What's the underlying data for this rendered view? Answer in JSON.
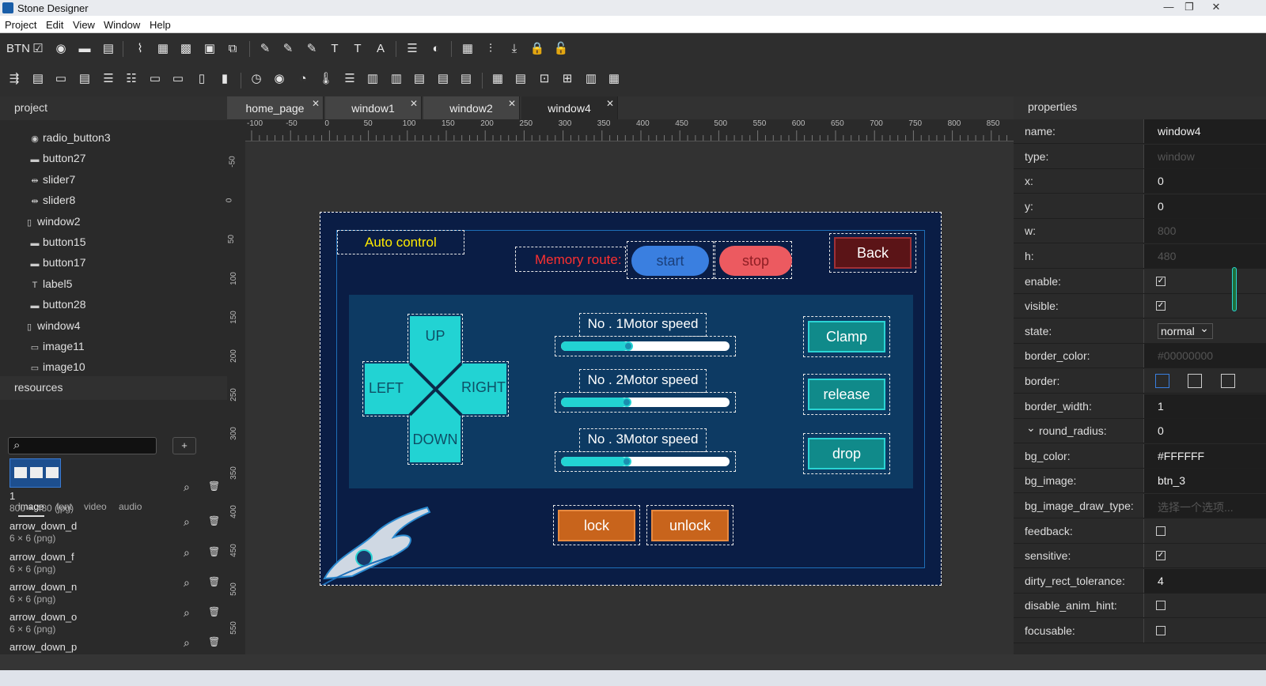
{
  "app": {
    "title": "Stone Designer"
  },
  "menu": [
    "Project",
    "Edit",
    "View",
    "Window",
    "Help"
  ],
  "window_controls": {
    "minimize": "—",
    "restore": "❐",
    "close": "✕"
  },
  "toolbar1": [
    "BTN",
    "☑",
    "◉",
    "▬",
    "▤",
    "⌇",
    "▦",
    "▩",
    "▣",
    "⧉",
    "✎",
    "✎",
    "✎",
    "T",
    "T",
    "A",
    "☰",
    "◐",
    "▦",
    "⫶",
    "⤓",
    "🔒",
    "🔓"
  ],
  "toolbar2": [
    "⇶",
    "▤",
    "▭",
    "▤",
    "☰",
    "☷",
    "▭",
    "▭",
    "▯",
    "▮",
    "◷",
    "◉",
    "◔",
    "🌡",
    "☰",
    "▥",
    "▥",
    "▤",
    "▤",
    "▤",
    "▦",
    "▤",
    "⊡",
    "⊞",
    "▥",
    "▦"
  ],
  "project": {
    "header": "project",
    "items": [
      {
        "label": "radio_button3",
        "icon": "◉",
        "level": 2
      },
      {
        "label": "button27",
        "icon": "▬",
        "level": 2
      },
      {
        "label": "slider7",
        "icon": "⇹",
        "level": 2
      },
      {
        "label": "slider8",
        "icon": "⇹",
        "level": 2
      },
      {
        "label": "window2",
        "icon": "▯",
        "level": 1
      },
      {
        "label": "button15",
        "icon": "▬",
        "level": 2
      },
      {
        "label": "button17",
        "icon": "▬",
        "level": 2
      },
      {
        "label": "label5",
        "icon": "T",
        "level": 2
      },
      {
        "label": "button28",
        "icon": "▬",
        "level": 2
      },
      {
        "label": "window4",
        "icon": "▯",
        "level": 1
      },
      {
        "label": "image11",
        "icon": "▭",
        "level": 2
      },
      {
        "label": "image10",
        "icon": "▭",
        "level": 2
      }
    ]
  },
  "resources": {
    "header": "resources",
    "tabs": [
      "image",
      "font",
      "video",
      "audio"
    ],
    "active_tab": "image",
    "search_placeholder": "",
    "add_label": "+",
    "assets": [
      {
        "name": "1",
        "size": "800 × 480 (jpg)"
      },
      {
        "name": "arrow_down_d",
        "size": "6 × 6 (png)"
      },
      {
        "name": "arrow_down_f",
        "size": "6 × 6 (png)"
      },
      {
        "name": "arrow_down_n",
        "size": "6 × 6 (png)"
      },
      {
        "name": "arrow_down_o",
        "size": "6 × 6 (png)"
      },
      {
        "name": "arrow_down_p",
        "size": ""
      }
    ]
  },
  "tabs": [
    {
      "label": "home_page",
      "active": false
    },
    {
      "label": "window1",
      "active": false
    },
    {
      "label": "window2",
      "active": false
    },
    {
      "label": "window4",
      "active": true
    }
  ],
  "ruler": {
    "h": [
      "-100",
      "-50",
      "0",
      "50",
      "100",
      "150",
      "200",
      "250",
      "300",
      "350",
      "400",
      "450",
      "500",
      "550",
      "600",
      "650",
      "700",
      "750",
      "800",
      "850"
    ],
    "v": [
      "-50",
      "0",
      "50",
      "100",
      "150",
      "200",
      "250",
      "300",
      "350",
      "400",
      "450",
      "500",
      "550"
    ]
  },
  "screen": {
    "auto_control": "Auto control",
    "memory_route": "Memory route:",
    "start": "start",
    "stop": "stop",
    "back": "Back",
    "up": "UP",
    "down": "DOWN",
    "left": "LEFT",
    "right": "RIGHT",
    "motors": [
      {
        "label": "No . 1Motor speed",
        "value": 0.4
      },
      {
        "label": "No . 2Motor speed",
        "value": 0.39
      },
      {
        "label": "No . 3Motor speed",
        "value": 0.39
      }
    ],
    "clamp": "Clamp",
    "release": "release",
    "drop": "drop",
    "lock": "lock",
    "unlock": "unlock"
  },
  "properties": {
    "header": "properties",
    "rows": [
      {
        "label": "name:",
        "value": "window4",
        "kind": "text"
      },
      {
        "label": "type:",
        "value": "window",
        "kind": "dim"
      },
      {
        "label": "x:",
        "value": "0",
        "kind": "text"
      },
      {
        "label": "y:",
        "value": "0",
        "kind": "text"
      },
      {
        "label": "w:",
        "value": "800",
        "kind": "dim"
      },
      {
        "label": "h:",
        "value": "480",
        "kind": "dim"
      },
      {
        "label": "enable:",
        "value": "✓",
        "kind": "check"
      },
      {
        "label": "visible:",
        "value": "✓",
        "kind": "check"
      },
      {
        "label": "state:",
        "value": "normal",
        "kind": "select"
      },
      {
        "label": "border_color:",
        "value": "#00000000",
        "kind": "dim"
      },
      {
        "label": "border:",
        "value": "",
        "kind": "border"
      },
      {
        "label": "border_width:",
        "value": "1",
        "kind": "text"
      },
      {
        "label": "round_radius:",
        "value": "0",
        "kind": "text"
      },
      {
        "label": "bg_color:",
        "value": "#FFFFFF",
        "kind": "text"
      },
      {
        "label": "bg_image:",
        "value": "btn_3",
        "kind": "text"
      },
      {
        "label": "bg_image_draw_type:",
        "value": "选择一个选项...",
        "kind": "dim"
      },
      {
        "label": "feedback:",
        "value": "",
        "kind": "check"
      },
      {
        "label": "sensitive:",
        "value": "✓",
        "kind": "check"
      },
      {
        "label": "dirty_rect_tolerance:",
        "value": "4",
        "kind": "text"
      },
      {
        "label": "disable_anim_hint:",
        "value": "",
        "kind": "check"
      },
      {
        "label": "focusable:",
        "value": "",
        "kind": "check"
      }
    ]
  },
  "colors": {
    "accent_cyan": "#22d3d3",
    "orange": "#c8641c",
    "red_label": "#ff3030",
    "yellow_label": "#ffea00"
  }
}
